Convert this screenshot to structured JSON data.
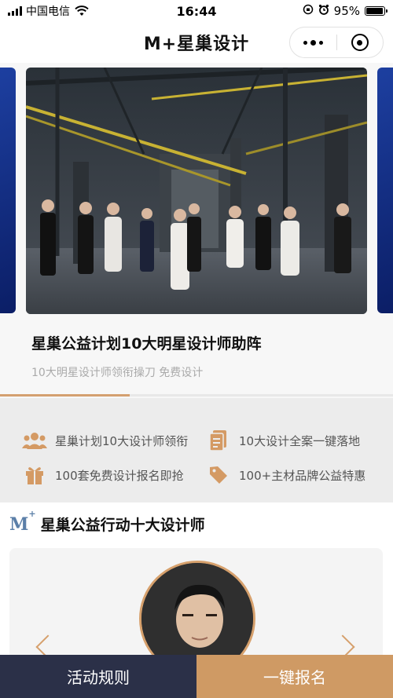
{
  "status_bar": {
    "carrier": "中国电信",
    "time": "16:44",
    "battery": "95%",
    "battery_level": 0.95
  },
  "nav": {
    "title": "M+星巢设计"
  },
  "banner": {
    "title": "星巢公益计划10大明星设计师助阵",
    "subtitle": "10大明星设计师领衔操刀 免费设计",
    "carousel_progress": 0.33
  },
  "features": [
    {
      "icon": "group-icon",
      "label": "星巢计划10大设计师领衔"
    },
    {
      "icon": "document-icon",
      "label": "10大设计全案一键落地"
    },
    {
      "icon": "gift-icon",
      "label": "100套免费设计报名即抢"
    },
    {
      "icon": "tag-icon",
      "label": "100+主材品牌公益特惠"
    }
  ],
  "section": {
    "logo_text": "M",
    "logo_sup": "+",
    "title": "星巢公益行动十大设计师"
  },
  "bottom": {
    "rules_label": "活动规则",
    "signup_label": "一键报名"
  },
  "colors": {
    "accent": "#d6a06c",
    "feature_icon": "#d49a64",
    "rules_bg": "#2b3048",
    "signup_bg": "#cf9a64"
  }
}
